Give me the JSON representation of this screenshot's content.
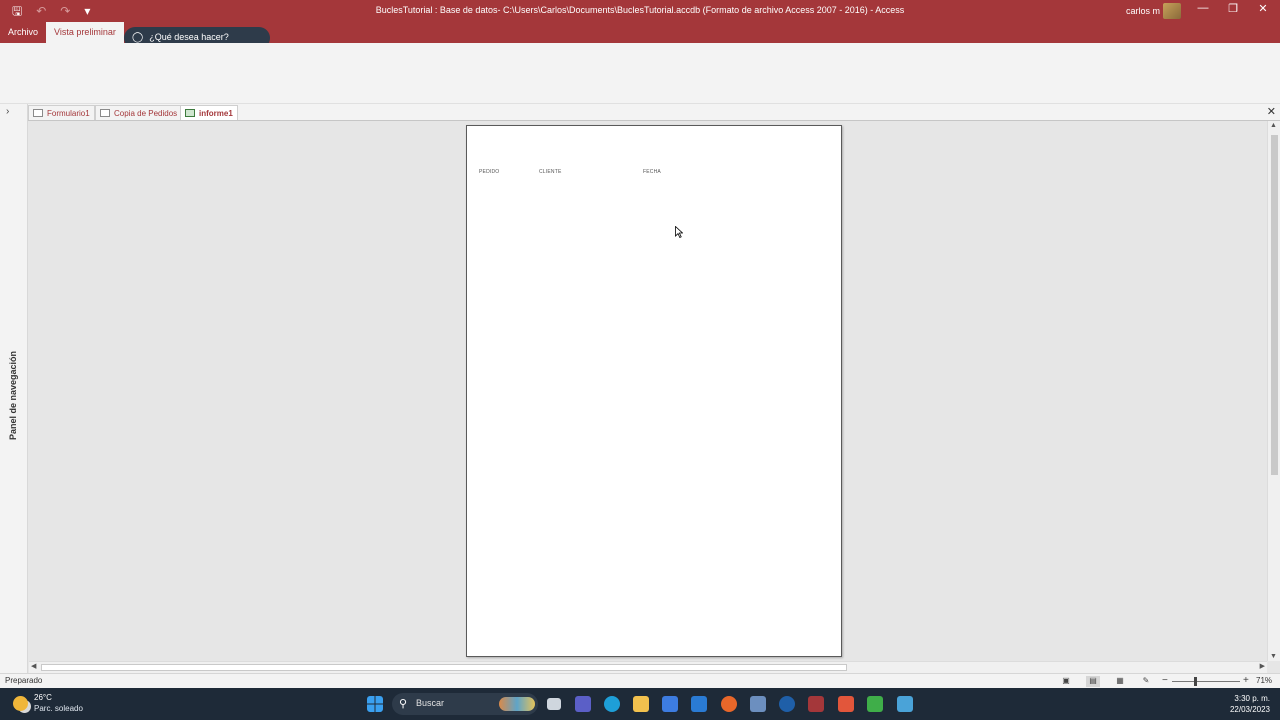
{
  "app": {
    "window_title": "BuclesTutorial : Base de datos- C:\\Users\\Carlos\\Documents\\BuclesTutorial.accdb (Formato de archivo Access 2007 - 2016)  -  Access",
    "user_name": "carlos m",
    "accent_color": "#a4373a"
  },
  "ribbon": {
    "tabs": [
      {
        "label": "Archivo",
        "active": false
      },
      {
        "label": "Vista preliminar",
        "active": true
      }
    ],
    "tell_me": "¿Qué desea hacer?"
  },
  "document_tabs": [
    {
      "label": "Formulario1",
      "icon": "form-icon",
      "active": false
    },
    {
      "label": "Copia de Pedidos",
      "icon": "table-icon",
      "active": false
    },
    {
      "label": "informe1",
      "icon": "report-icon",
      "active": true
    }
  ],
  "nav_pane": {
    "label": "Panel de navegación"
  },
  "report": {
    "columns": [
      "PEDIDO",
      "CLIENTE",
      "FECHA"
    ]
  },
  "status_bar": {
    "status": "Preparado",
    "zoom": "71%",
    "zoom_level": 0.71
  },
  "taskbar": {
    "weather_temp": "26°C",
    "weather_condition": "Parc. soleado",
    "search_label": "Buscar",
    "time": "3:30 p. m.",
    "date": "22/03/2023"
  }
}
